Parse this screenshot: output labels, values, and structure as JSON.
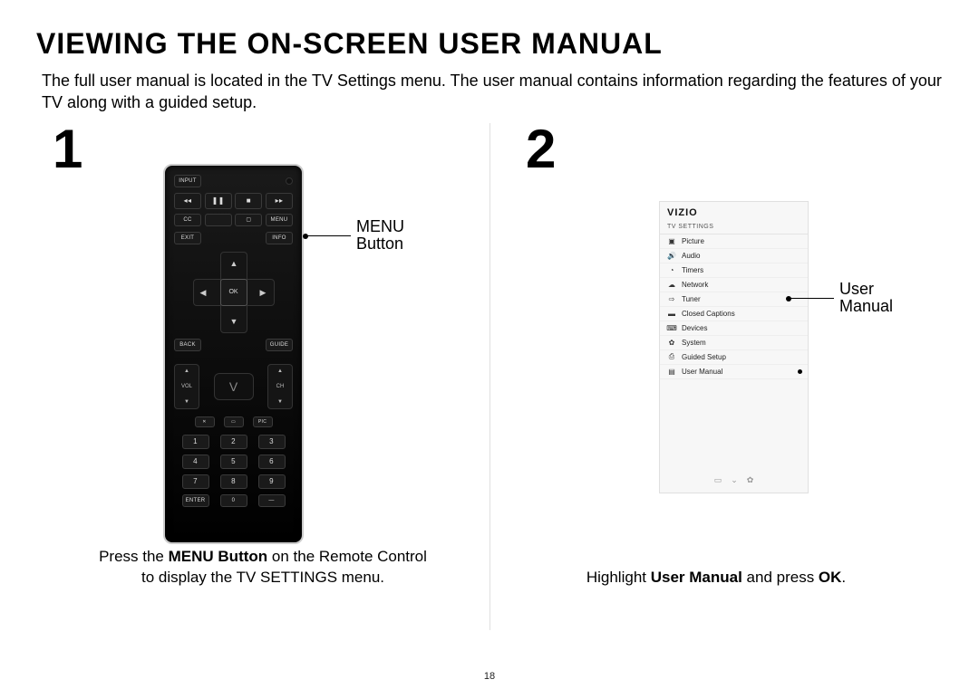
{
  "title": "VIEWING THE ON-SCREEN USER MANUAL",
  "intro": "The full user manual is located in the TV Settings menu. The user manual contains information regarding the features of your TV along with a guided setup.",
  "page_number": "18",
  "step1": {
    "number": "1",
    "callout_line1": "MENU",
    "callout_line2": "Button",
    "caption_pre": "Press the ",
    "caption_bold": "MENU Button",
    "caption_mid": " on the Remote Control",
    "caption_line2": "to display the TV SETTINGS menu."
  },
  "step2": {
    "number": "2",
    "callout_line1": "User",
    "callout_line2": "Manual",
    "caption_pre": "Highlight ",
    "caption_bold1": "User Manual",
    "caption_mid": " and press ",
    "caption_bold2": "OK",
    "caption_post": "."
  },
  "remote": {
    "input": "INPUT",
    "rew": "◂◂",
    "play": "❚❚",
    "stop": "■",
    "ffwd": "▸▸",
    "cc": "CC",
    "blank": "",
    "vbtn": "▢",
    "menu": "MENU",
    "exit": "EXIT",
    "info": "INFO",
    "ok": "OK",
    "back": "BACK",
    "guide": "GUIDE",
    "vol": "VOL",
    "ch": "CH",
    "mute": "✕",
    "wide": "▭",
    "pic": "PIC",
    "n1": "1",
    "n2": "2",
    "n3": "3",
    "n4": "4",
    "n5": "5",
    "n6": "6",
    "n7": "7",
    "n8": "8",
    "n9": "9",
    "enter": "ENTER",
    "n0": "0",
    "dash": "—"
  },
  "tvpanel": {
    "brand": "VIZIO",
    "header": "TV SETTINGS",
    "items": [
      {
        "icon": "▣",
        "label": "Picture"
      },
      {
        "icon": "🔊",
        "label": "Audio"
      },
      {
        "icon": "◔",
        "label": "Timers"
      },
      {
        "icon": "☁",
        "label": "Network"
      },
      {
        "icon": "⇨",
        "label": "Tuner"
      },
      {
        "icon": "▬",
        "label": "Closed Captions"
      },
      {
        "icon": "⌨",
        "label": "Devices"
      },
      {
        "icon": "✿",
        "label": "System"
      },
      {
        "icon": "⎙",
        "label": "Guided Setup"
      },
      {
        "icon": "▤",
        "label": "User Manual"
      }
    ],
    "foot1": "▭",
    "foot2": "⌄",
    "foot3": "✿"
  }
}
